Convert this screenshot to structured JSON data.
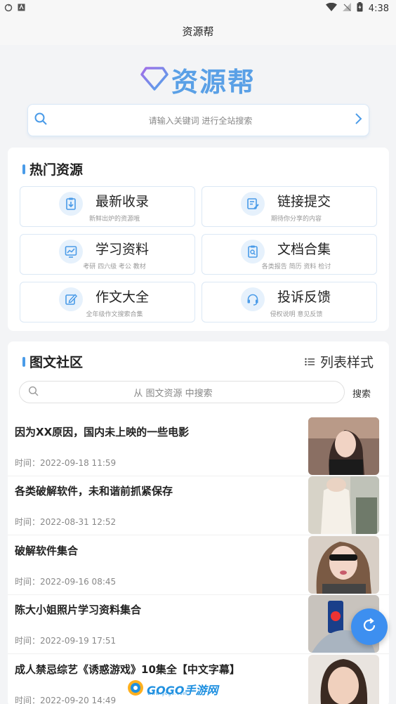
{
  "status": {
    "time": "4:38"
  },
  "title": "资源帮",
  "logo": {
    "text": "资源帮"
  },
  "search": {
    "placeholder": "请输入关键词 进行全站搜索"
  },
  "hot": {
    "title": "热门资源",
    "tiles": [
      {
        "title": "最新收录",
        "sub": "新鲜出炉的资源哦",
        "icon": "clipboard-download-icon"
      },
      {
        "title": "链接提交",
        "sub": "期待你分享的内容",
        "icon": "edit-list-icon"
      },
      {
        "title": "学习资料",
        "sub": "考研 四六级 考公 教材",
        "icon": "chart-icon"
      },
      {
        "title": "文档合集",
        "sub": "各类报告 简历 资料 检讨",
        "icon": "document-search-icon"
      },
      {
        "title": "作文大全",
        "sub": "全年级作文搜索合集",
        "icon": "pencil-icon"
      },
      {
        "title": "投诉反馈",
        "sub": "侵权说明 意见反馈",
        "icon": "headset-icon"
      }
    ]
  },
  "community": {
    "title": "图文社区",
    "list_style": "列表样式",
    "search_placeholder": "从 图文资源 中搜索",
    "search_button": "搜索",
    "items": [
      {
        "title": "因为XX原因，国内未上映的一些电影",
        "time": "时间：2022-09-18 11:59"
      },
      {
        "title": "各类破解软件，未和谐前抓紧保存",
        "time": "时间：2022-08-31 12:52"
      },
      {
        "title": "破解软件集合",
        "time": "时间：2022-09-16 08:45"
      },
      {
        "title": "陈大小姐照片学习资料集合",
        "time": "时间：2022-09-19 17:51"
      },
      {
        "title": "成人禁忌综艺《诱惑游戏》10集全【中文字幕】",
        "time": "时间：2022-09-20 14:49"
      }
    ]
  },
  "watermark": {
    "text": "GOGO手游网",
    "sub": "www.gogo.com"
  },
  "colors": {
    "accent": "#4a9be8",
    "fab": "#3d8ff0",
    "logo": "#5aa0e6"
  }
}
